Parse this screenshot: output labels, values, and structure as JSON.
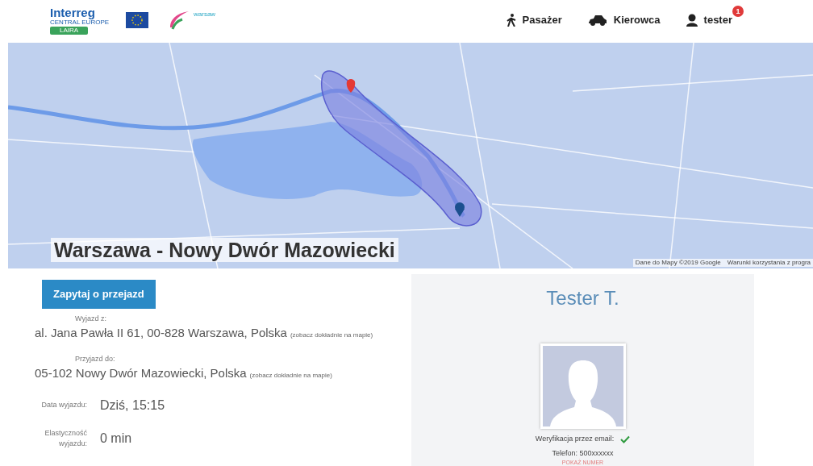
{
  "header": {
    "logos": [
      {
        "kind": "interreg",
        "title": "Interreg",
        "subtitle": "CENTRAL EUROPE",
        "project": "LAIRA"
      },
      {
        "kind": "warsaw",
        "label": "warsaw"
      }
    ],
    "nav": [
      {
        "kind": "passenger",
        "label": "Pasażer"
      },
      {
        "kind": "driver",
        "label": "Kierowca"
      },
      {
        "kind": "user",
        "label": "tester",
        "badge": "1"
      }
    ]
  },
  "map": {
    "route_title": "Warszawa - Nowy Dwór Mazowiecki",
    "attribution": [
      "Dane do Mapy ©2019 Google",
      "Warunki korzystania z progra"
    ]
  },
  "ask_button": "Zapytaj o przejazd",
  "trip": {
    "places": [
      {
        "label": "Wyjazd z:",
        "address": "al. Jana Pawła II 61, 00-828 Warszawa, Polska",
        "map_link": "(zobacz dokładnie na mapie)"
      },
      {
        "label": "Przyjazd do:",
        "address": "05-102 Nowy Dwór Mazowiecki, Polska",
        "map_link": "(zobacz dokładnie na mapie)"
      }
    ],
    "details": [
      {
        "label": "Data wyjazdu:",
        "value": "Dziś, 15:15"
      },
      {
        "label": "Elastyczność wyjazdu:",
        "value": "0 min"
      }
    ]
  },
  "driver": {
    "name": "Tester T.",
    "email_label": "Weryfikacja przez email:",
    "email_verified": true,
    "phone": "Telefon: 500xxxxxx",
    "show_number": "POKAŻ NUMER"
  }
}
